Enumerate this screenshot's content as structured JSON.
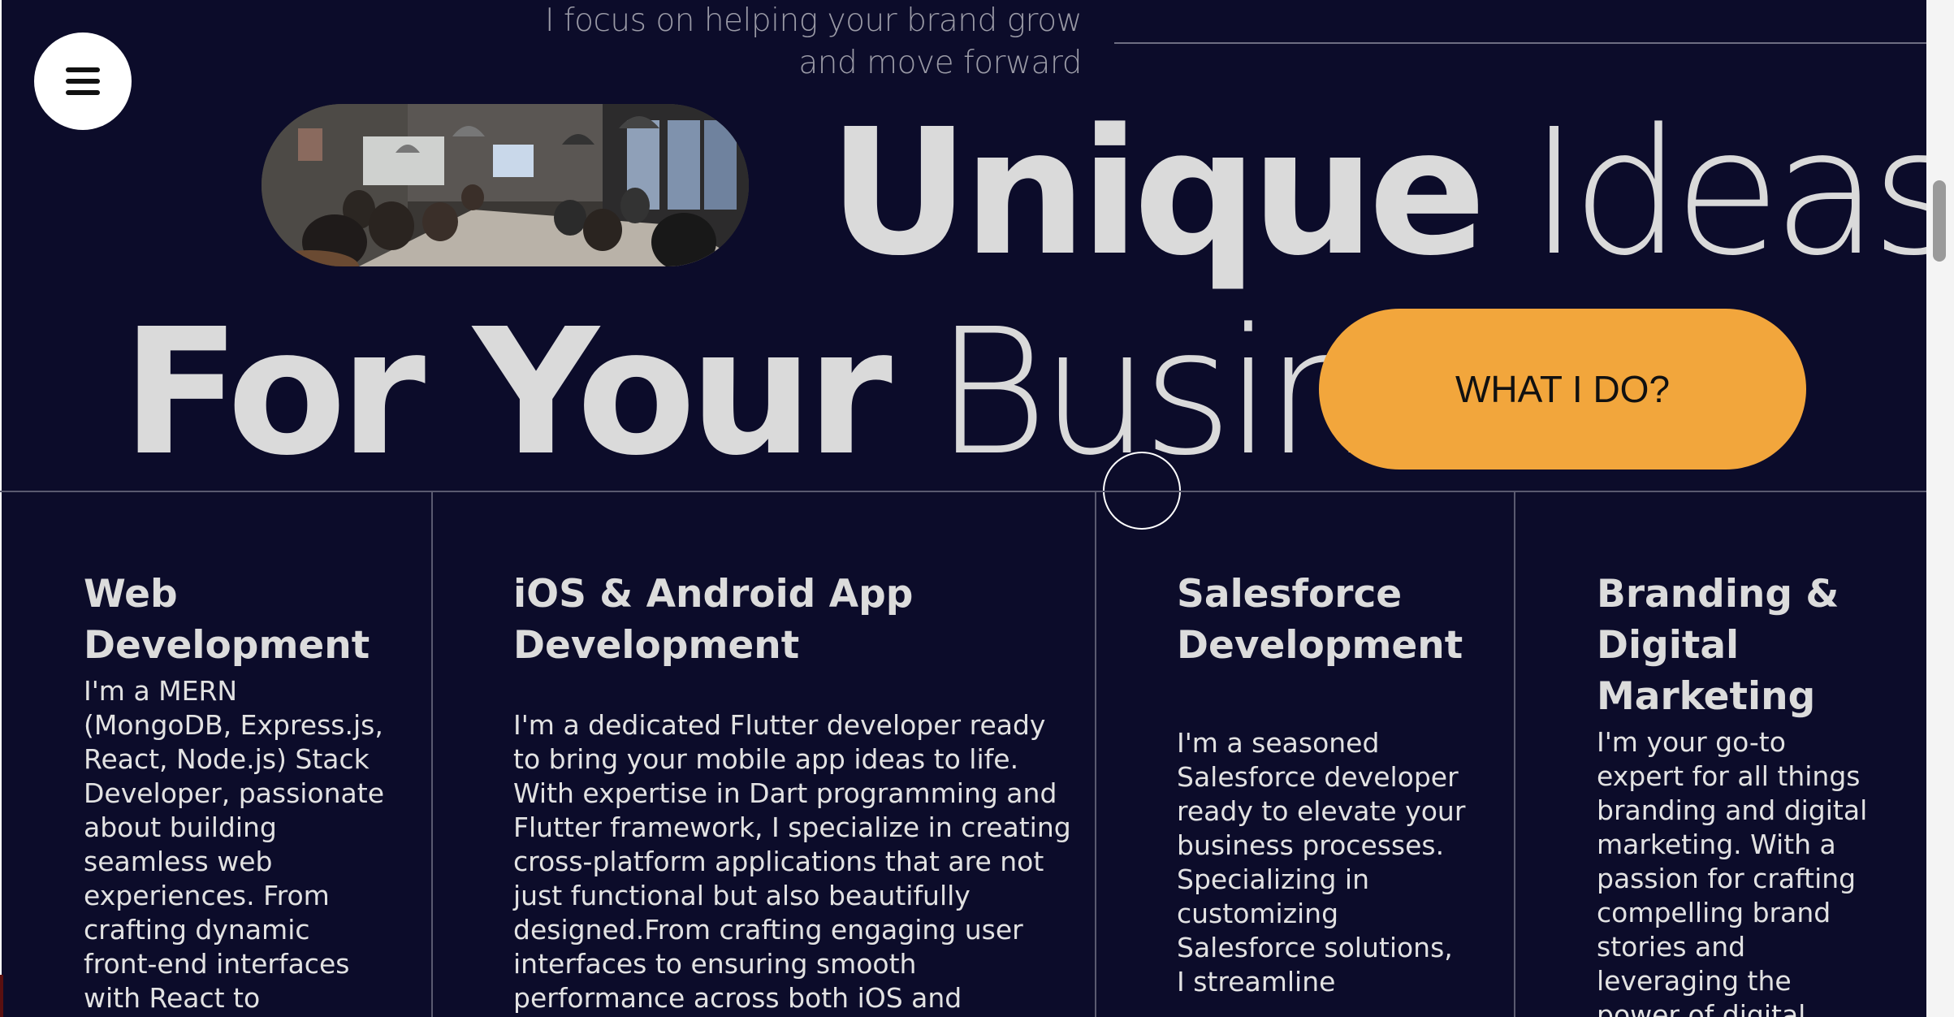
{
  "header": {
    "tagline": "I focus on helping your brand grow\nand move forward"
  },
  "menu": {
    "icon": "hamburger-menu-icon"
  },
  "hero": {
    "image_alt": "meeting-room-photo",
    "headline_line1_bold": "Unique",
    "headline_line1_thin": "Ideas",
    "headline_line2_bold": "For Your",
    "headline_line2_thin": "Business.",
    "cta_label": "WHAT I DO?"
  },
  "colors": {
    "background": "#0c0c2a",
    "accent": "#f2a63c",
    "text": "#dadada"
  },
  "services": [
    {
      "title": "Web\nDevelopment",
      "body": "I'm a MERN\n(MongoDB, Express.js,\nReact, Node.js) Stack\nDeveloper, passionate\nabout building\nseamless web\nexperiences. From\ncrafting dynamic\nfront-end interfaces\nwith React to"
    },
    {
      "title": "iOS & Android App\nDevelopment",
      "body": "I'm a dedicated Flutter developer ready\nto bring your mobile app ideas to life.\nWith expertise in Dart programming and\nFlutter framework, I specialize in creating\ncross-platform applications that are not\njust functional but also beautifully\ndesigned.From crafting engaging user\ninterfaces to ensuring smooth\nperformance across both iOS and"
    },
    {
      "title": "Salesforce\nDevelopment",
      "body": "I'm a seasoned\nSalesforce developer\nready to elevate your\nbusiness processes.\nSpecializing in\ncustomizing\nSalesforce solutions,\nI streamline"
    },
    {
      "title": "Branding &\nDigital\nMarketing",
      "body": "I'm your go-to\nexpert for all things\nbranding and digital\nmarketing. With a\npassion for crafting\ncompelling brand\nstories and\nleveraging the\npower of digital"
    }
  ]
}
